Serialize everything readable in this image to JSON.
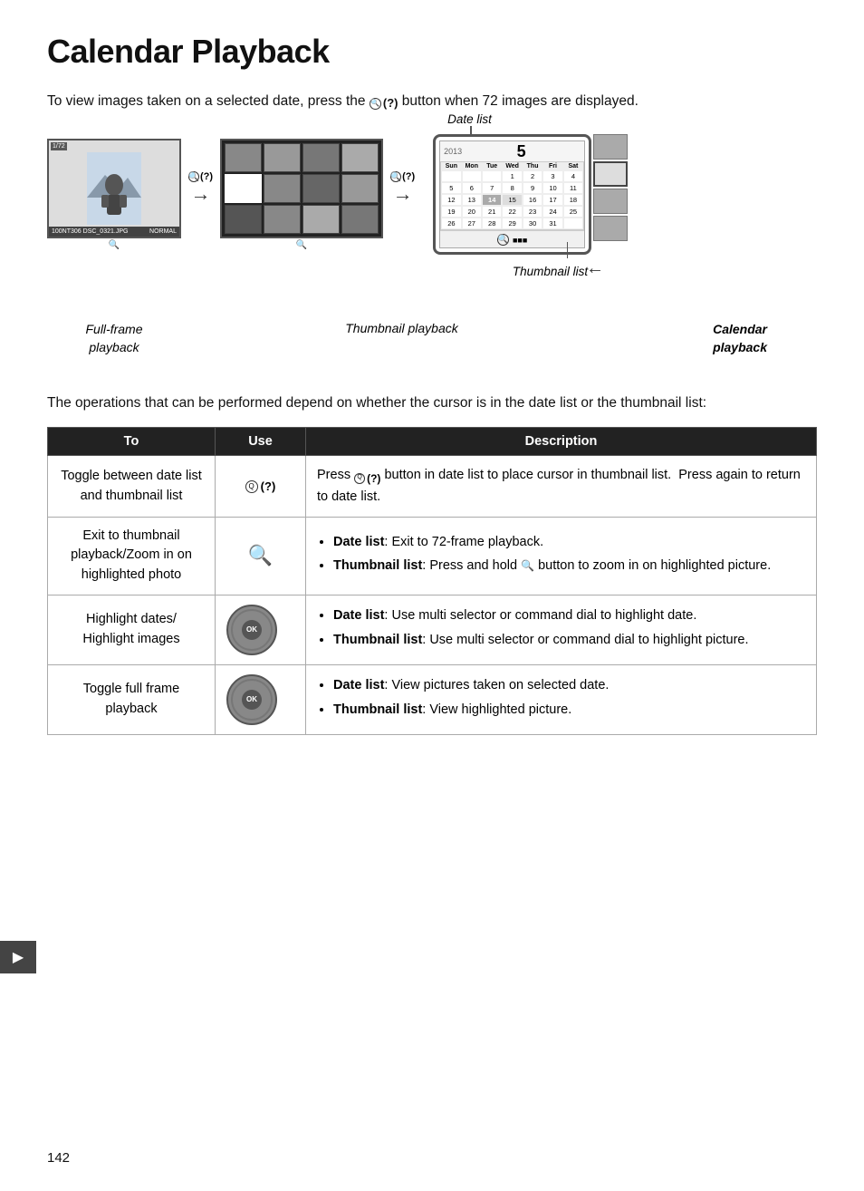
{
  "page": {
    "title": "Calendar Playback",
    "page_number": "142",
    "intro": "To view images taken on a selected date, press the  (",
    "intro2": ") button when 72 images are displayed.",
    "operations_text": "The operations that can be performed depend on whether the cursor is in the date list or the thumbnail list:",
    "diagram": {
      "date_list_label": "Date list",
      "thumbnail_list_label": "Thumbnail list",
      "ff_label": "Full-frame\nplayback",
      "thumb_label": "Thumbnail playback",
      "cal_label": "Calendar\nplayback"
    },
    "table": {
      "headers": [
        "To",
        "Use",
        "Description"
      ],
      "rows": [
        {
          "to": "Toggle between date list and thumbnail list",
          "use": "q_button",
          "desc_plain": "Press  () button in date list to place cursor in thumbnail list.  Press again to return to date list.",
          "desc_parts": [
            {
              "text": "Press ",
              "bold": false
            },
            {
              "text": " (?) button in date list to place cursor in thumbnail list.  Press again to return to date list.",
              "bold": false
            }
          ]
        },
        {
          "to": "Exit to thumbnail playback/Zoom in on highlighted photo",
          "use": "zoom_button",
          "desc_bullets": [
            {
              "label": "Date list",
              "text": ": Exit to 72-frame playback."
            },
            {
              "label": "Thumbnail list",
              "text": ": Press and hold  button to zoom in on highlighted picture."
            }
          ]
        },
        {
          "to": "Highlight dates/ Highlight images",
          "use": "ok_button",
          "desc_bullets": [
            {
              "label": "Date list",
              "text": ": Use multi selector or command dial to highlight date."
            },
            {
              "label": "Thumbnail list",
              "text": ": Use multi selector or command dial to highlight picture."
            }
          ]
        },
        {
          "to": "Toggle full frame playback",
          "use": "ok_button",
          "desc_bullets": [
            {
              "label": "Date list",
              "text": ": View pictures taken on selected date."
            },
            {
              "label": "Thumbnail list",
              "text": ": View highlighted picture."
            }
          ]
        }
      ]
    },
    "calendar": {
      "year": "2013",
      "month": "5",
      "day_headers": [
        "Sun",
        "Mon",
        "Tue",
        "Wed",
        "Thu",
        "Fri",
        "Sat"
      ],
      "weeks": [
        [
          "",
          "",
          "",
          "1",
          "2",
          "3",
          "4"
        ],
        [
          "5",
          "6",
          "7",
          "8",
          "9",
          "10",
          "11"
        ],
        [
          "12",
          "13",
          "14",
          "15",
          "16",
          "17",
          "18"
        ],
        [
          "19",
          "20",
          "21",
          "22",
          "23",
          "24",
          "25"
        ],
        [
          "26",
          "27",
          "28",
          "29",
          "30",
          "31",
          ""
        ]
      ],
      "highlighted_day": "14"
    }
  }
}
